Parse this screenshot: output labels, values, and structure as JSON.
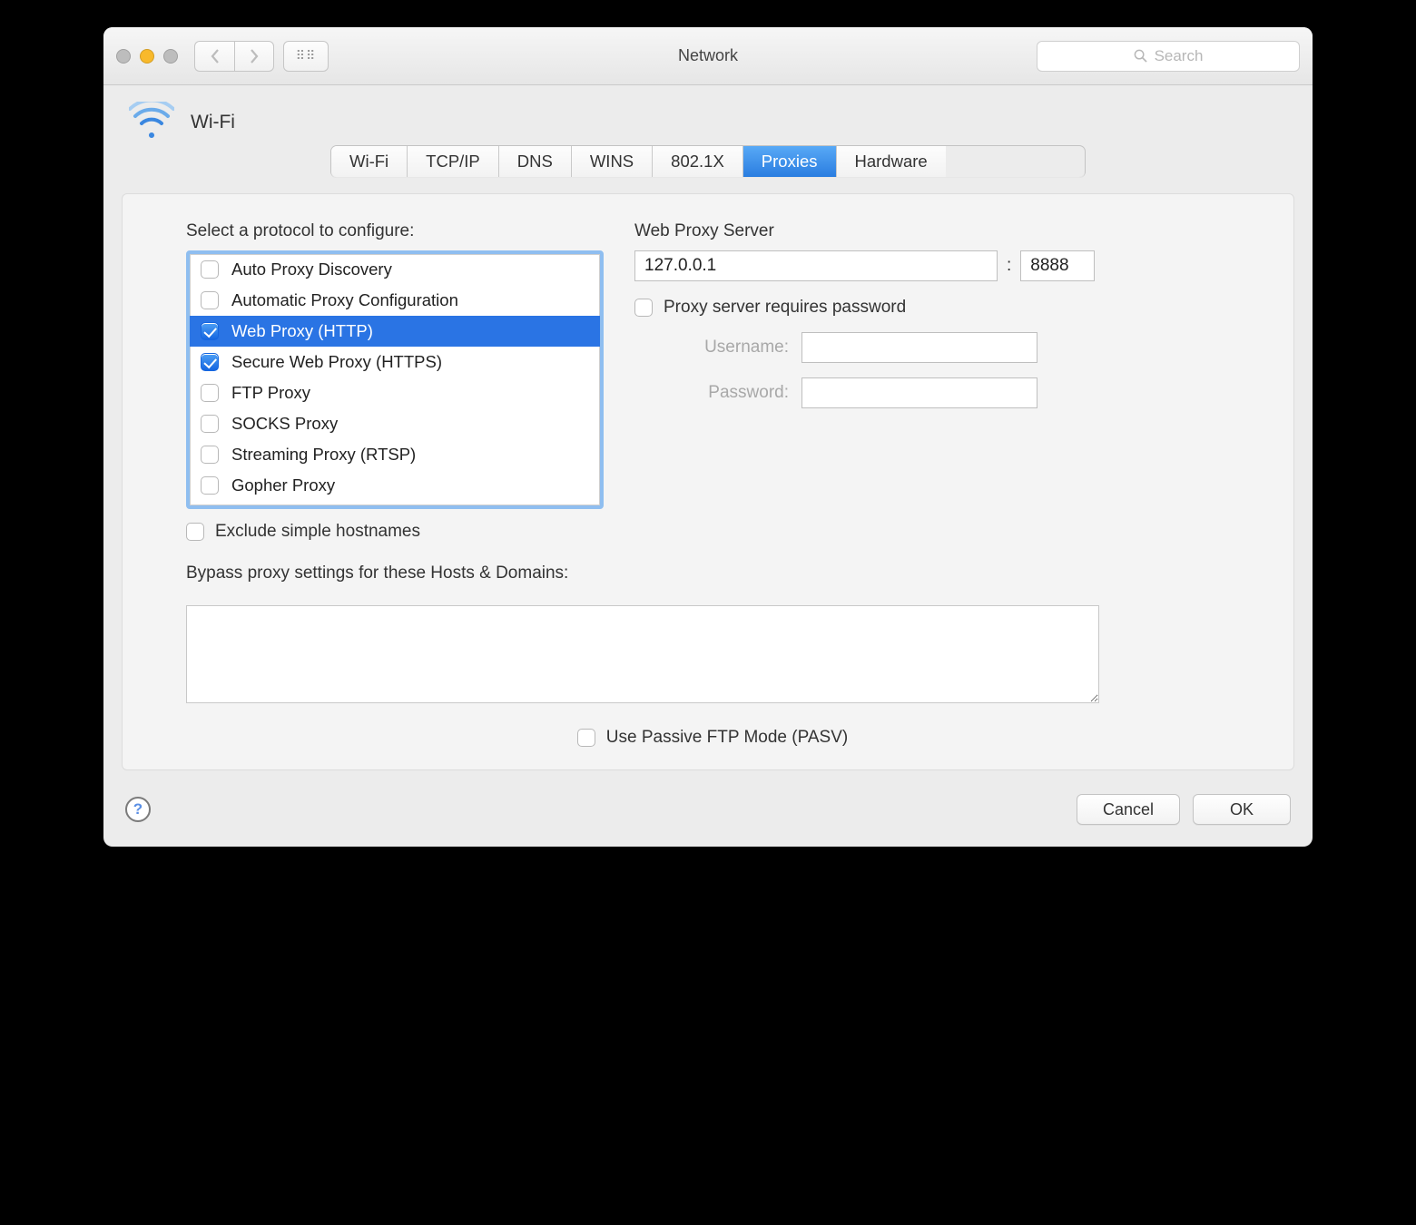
{
  "window": {
    "title": "Network"
  },
  "search": {
    "placeholder": "Search"
  },
  "panel_name": "Wi-Fi",
  "tabs": [
    {
      "label": "Wi-Fi",
      "active": false
    },
    {
      "label": "TCP/IP",
      "active": false
    },
    {
      "label": "DNS",
      "active": false
    },
    {
      "label": "WINS",
      "active": false
    },
    {
      "label": "802.1X",
      "active": false
    },
    {
      "label": "Proxies",
      "active": true
    },
    {
      "label": "Hardware",
      "active": false
    }
  ],
  "protocol_label": "Select a protocol to configure:",
  "protocols": [
    {
      "label": "Auto Proxy Discovery",
      "checked": false,
      "selected": false
    },
    {
      "label": "Automatic Proxy Configuration",
      "checked": false,
      "selected": false
    },
    {
      "label": "Web Proxy (HTTP)",
      "checked": true,
      "selected": true
    },
    {
      "label": "Secure Web Proxy (HTTPS)",
      "checked": true,
      "selected": false
    },
    {
      "label": "FTP Proxy",
      "checked": false,
      "selected": false
    },
    {
      "label": "SOCKS Proxy",
      "checked": false,
      "selected": false
    },
    {
      "label": "Streaming Proxy (RTSP)",
      "checked": false,
      "selected": false
    },
    {
      "label": "Gopher Proxy",
      "checked": false,
      "selected": false
    }
  ],
  "exclude_simple": {
    "label": "Exclude simple hostnames",
    "checked": false
  },
  "server": {
    "label": "Web Proxy Server",
    "host": "127.0.0.1",
    "separator": ":",
    "port": "8888"
  },
  "requires_password": {
    "label": "Proxy server requires password",
    "checked": false
  },
  "username": {
    "label": "Username:",
    "value": ""
  },
  "password": {
    "label": "Password:",
    "value": ""
  },
  "bypass": {
    "label": "Bypass proxy settings for these Hosts & Domains:",
    "value": ""
  },
  "pasv": {
    "label": "Use Passive FTP Mode (PASV)",
    "checked": false
  },
  "buttons": {
    "cancel": "Cancel",
    "ok": "OK"
  },
  "help_glyph": "?"
}
